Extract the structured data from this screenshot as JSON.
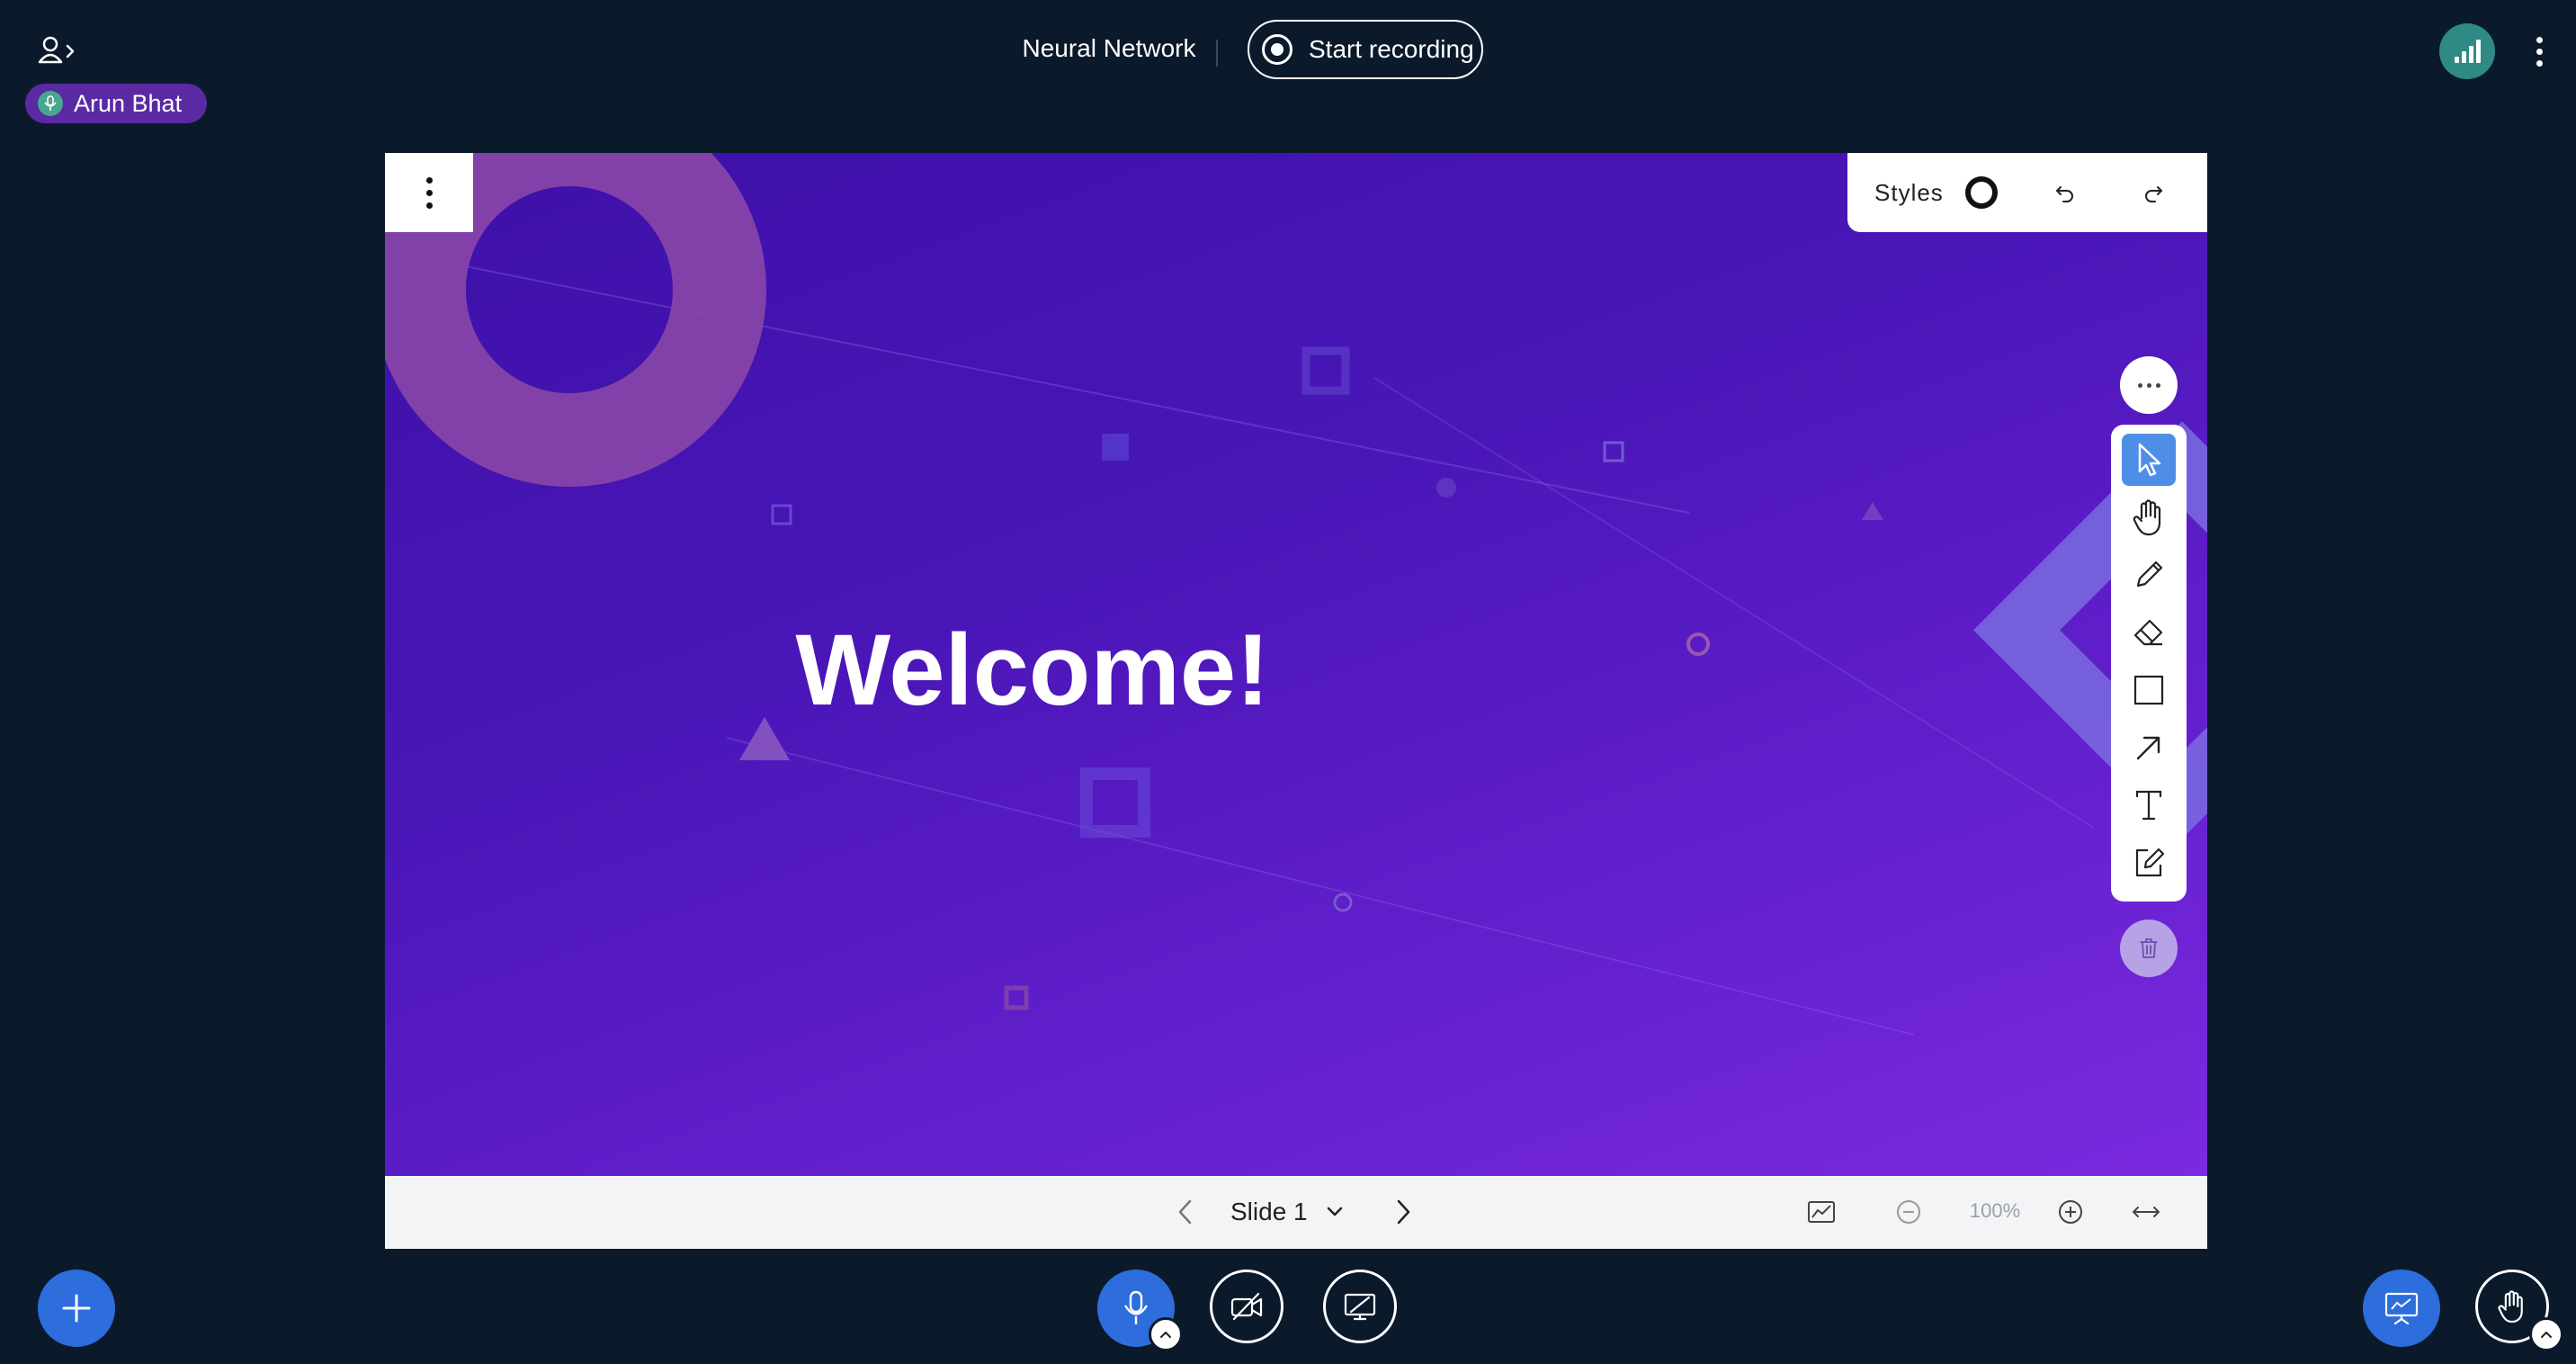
{
  "header": {
    "meeting_title": "Neural Network",
    "record_label": "Start recording",
    "user_list_icon": "user-list-toggle-icon",
    "connection_icon": "signal-bars-icon",
    "options_icon": "vertical-dots-icon"
  },
  "talker": {
    "name": "Arun Bhat",
    "icon": "microphone-icon",
    "color": "#5a2aa3"
  },
  "whiteboard": {
    "slide_title": "Welcome!",
    "styles_label": "Styles",
    "tools": [
      {
        "name": "select",
        "icon": "pointer-icon",
        "active": true
      },
      {
        "name": "pan",
        "icon": "hand-icon",
        "active": false
      },
      {
        "name": "draw",
        "icon": "pencil-icon",
        "active": false
      },
      {
        "name": "eraser",
        "icon": "eraser-icon",
        "active": false
      },
      {
        "name": "rectangle",
        "icon": "rectangle-icon",
        "active": false
      },
      {
        "name": "arrow",
        "icon": "arrow-icon",
        "active": false
      },
      {
        "name": "text",
        "icon": "text-icon",
        "active": false
      },
      {
        "name": "note",
        "icon": "sticky-note-icon",
        "active": false
      }
    ],
    "accent_color": "#4f8ee6"
  },
  "slide_nav": {
    "slide_label": "Slide 1",
    "zoom_label": "100%"
  },
  "colors": {
    "background": "#0b1a2b",
    "primary_button": "#2d6ddc",
    "slide_gradient_start": "#3d10a8",
    "slide_gradient_end": "#7a2ae0"
  }
}
